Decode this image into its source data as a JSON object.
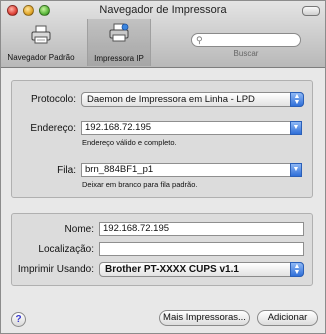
{
  "window": {
    "title": "Navegador de Impressora"
  },
  "toolbar": {
    "default_browser_label": "Navegador Padrão",
    "ip_printer_label": "Impressora IP",
    "search_placeholder": "",
    "search_caption": "Buscar"
  },
  "top_panel": {
    "protocol_label": "Protocolo:",
    "protocol_value": "Daemon de Impressora em Linha - LPD",
    "address_label": "Endereço:",
    "address_value": "192.168.72.195",
    "address_hint": "Endereço válido e completo.",
    "queue_label": "Fila:",
    "queue_value": "brn_884BF1_p1",
    "queue_hint": "Deixar em branco para fila padrão."
  },
  "bottom_panel": {
    "name_label": "Nome:",
    "name_value": "192.168.72.195",
    "location_label": "Localização:",
    "location_value": "",
    "print_using_label": "Imprimir Usando:",
    "print_using_value": "Brother PT-XXXX CUPS v1.1"
  },
  "footer": {
    "help_symbol": "?",
    "more_printers_label": "Mais Impressoras...",
    "add_label": "Adicionar"
  },
  "colors": {
    "accent": "#2f6fd8",
    "window_bg": "#e8e8e8",
    "panel_bg": "#dcdcdc"
  },
  "icons": [
    "close-icon",
    "minimize-icon",
    "zoom-icon",
    "printer-icon",
    "ip-printer-icon",
    "search-icon",
    "help-icon",
    "popup-arrows-icon",
    "combo-dropdown-icon"
  ]
}
